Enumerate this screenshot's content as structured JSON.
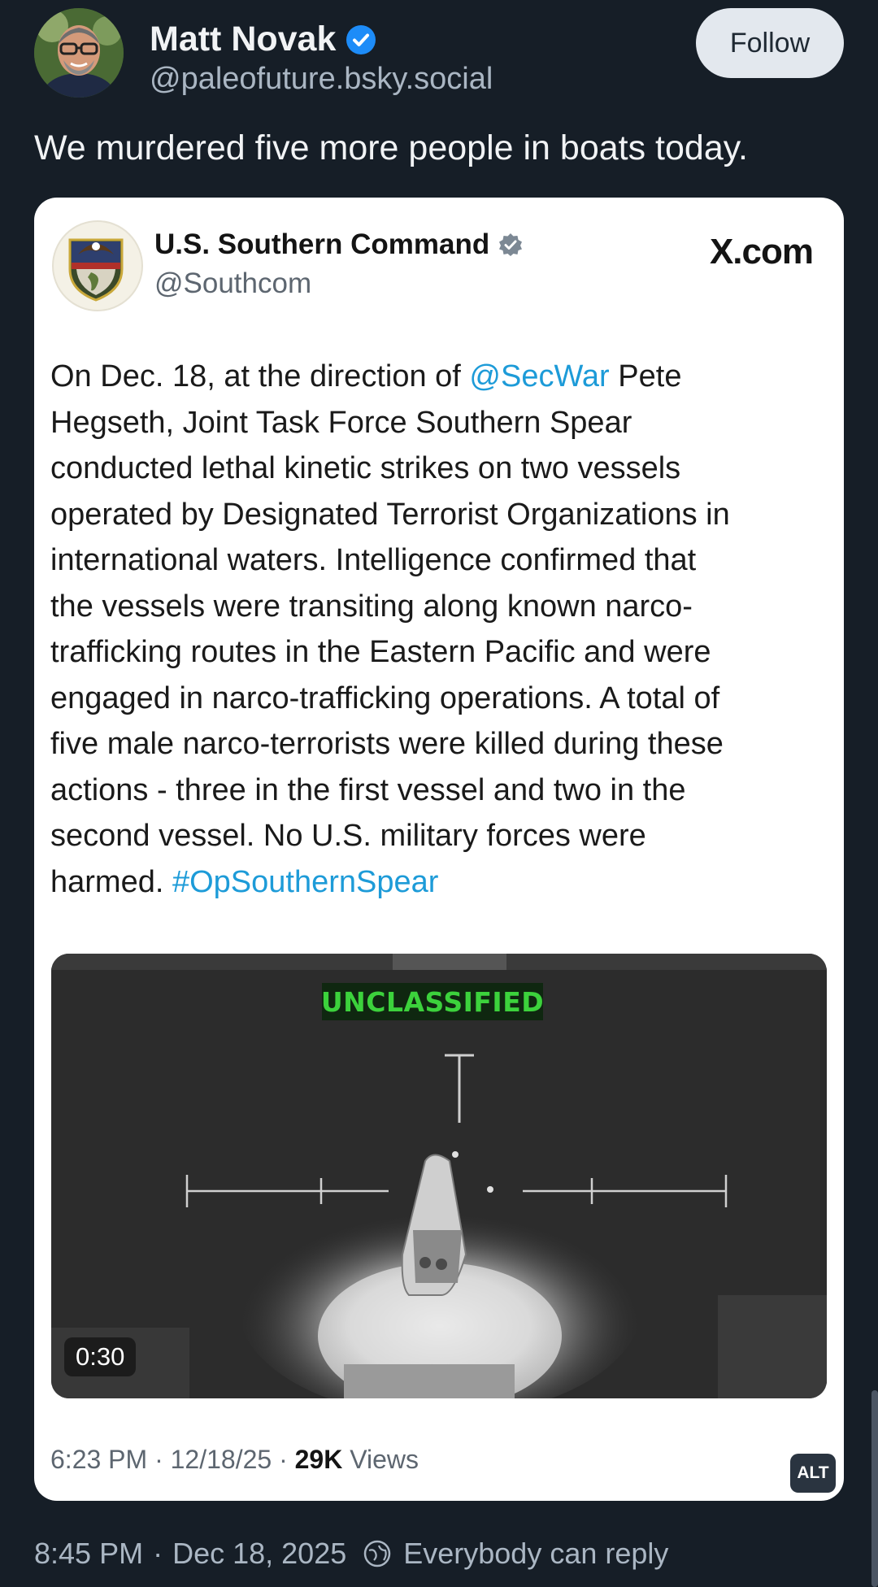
{
  "post": {
    "author_name": "Matt Novak",
    "author_handle": "@paleofuture.bsky.social",
    "follow_label": "Follow",
    "text": "We murdered five more people in boats today.",
    "time": "8:45 PM",
    "separator": "·",
    "date": "Dec 18, 2025",
    "reply_setting": "Everybody can reply"
  },
  "embed": {
    "name": "U.S. Southern Command",
    "handle": "@Southcom",
    "source": "X.com",
    "body": {
      "l1_a": "On Dec. 18, at the direction of ",
      "l1_link": "@SecWar",
      "l1_b": " Pete",
      "l2": "Hegseth, Joint Task Force Southern Spear",
      "l3": "conducted lethal kinetic strikes on two vessels",
      "l4": "operated by Designated Terrorist Organizations in",
      "l5": "international waters. Intelligence confirmed that",
      "l6": "the vessels were transiting along known narco-",
      "l7": "trafficking routes in the Eastern Pacific and were",
      "l8": "engaged in narco-trafficking operations. A total of",
      "l9": "five male narco-terrorists were killed during these",
      "l10": "actions - three in the first vessel and two in the",
      "l11": "second vessel. No U.S. military forces were",
      "l12_a": "harmed. ",
      "l12_link": "#OpSouthernSpear"
    },
    "video": {
      "overlay_label": "UNCLASSIFIED",
      "duration": "0:30"
    },
    "meta": {
      "time_date": "6:23 PM · 12/18/25 · ",
      "views_count": "29K",
      "views_label": " Views"
    },
    "alt_badge": "ALT"
  },
  "colors": {
    "page_bg": "#161e27",
    "link": "#1d9bd8",
    "verified": "#1d8cf8",
    "hud_green": "#3cd23c"
  },
  "icons": [
    "verified-icon",
    "gray-verified-icon",
    "reply-settings-icon"
  ]
}
